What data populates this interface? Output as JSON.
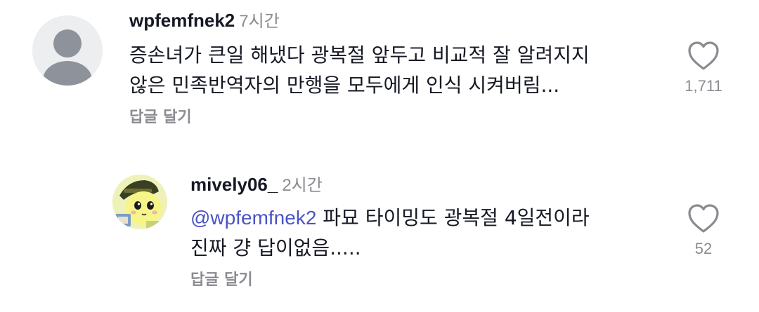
{
  "comments": [
    {
      "username": "wpfemfnek2",
      "time": "7시간",
      "line1": "증손녀가 큰일 해냈다 광복절 앞두고 비교적 잘 알려지지",
      "line2": "않은 민족반역자의 만행을 모두에게 인식 시켜버림...",
      "reply_label": "답글 달기",
      "like_count": "1,711",
      "like_icon": "heart-outline-icon"
    },
    {
      "username": "mively06_",
      "time": "2시간",
      "mention": "@wpfemfnek2",
      "line1": " 파묘 타이밍도 광복절 4일전이라",
      "line2": "진짜 걍 답이없음.....",
      "reply_label": "답글 달기",
      "like_count": "52",
      "like_icon": "heart-outline-icon"
    }
  ],
  "colors": {
    "text": "#161823",
    "secondary": "#8a8b91",
    "mention": "#4a52c5"
  }
}
